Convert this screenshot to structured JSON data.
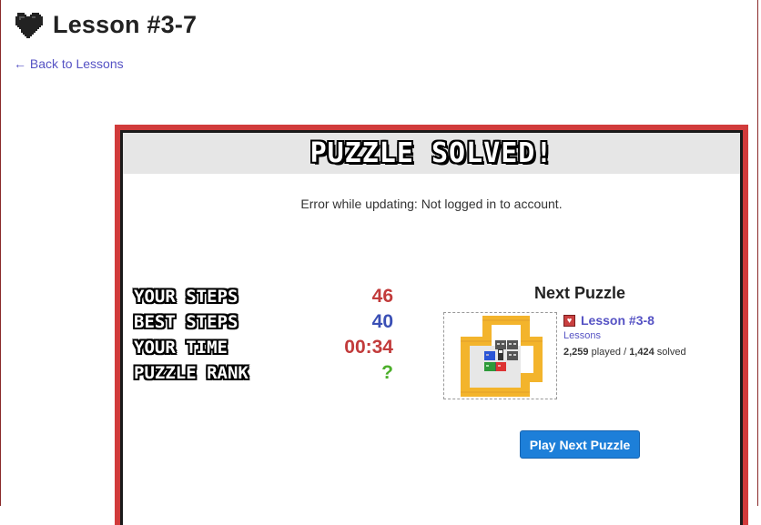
{
  "header": {
    "title": "Lesson #3-7",
    "back_link": "← Back to Lessons"
  },
  "modal": {
    "title": "PUZZLE SOLVED!",
    "error_message": "Error while updating: Not logged in to account.",
    "stats": [
      {
        "label": "YOUR STEPS",
        "value": "46",
        "color": "#c23b3b"
      },
      {
        "label": "BEST STEPS",
        "value": "40",
        "color": "#3a4fb5"
      },
      {
        "label": "YOUR TIME",
        "value": "00:34",
        "color": "#c23b3b"
      },
      {
        "label": "PUZZLE RANK",
        "value": "?",
        "color": "#4caf2a"
      }
    ],
    "next": {
      "heading": "Next Puzzle",
      "name": "Lesson #3-8",
      "category": "Lessons",
      "played_count": "2,259",
      "played_label": "played /",
      "solved_count": "1,424",
      "solved_label": "solved"
    },
    "play_button": "Play Next Puzzle"
  },
  "colors": {
    "accent_red": "#d13b3b",
    "link": "#5552c4",
    "button": "#1d7fd9",
    "wall": "#f3b42c"
  }
}
